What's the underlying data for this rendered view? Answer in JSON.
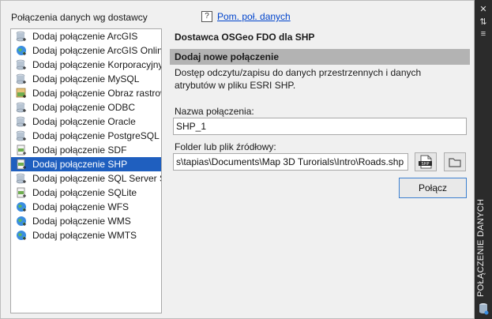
{
  "left_panel": {
    "title": "Połączenia danych wg dostawcy",
    "providers": [
      {
        "label": "Dodaj połączenie ArcGIS",
        "icon": "database-icon"
      },
      {
        "label": "Dodaj połączenie ArcGIS Online",
        "icon": "globe-icon"
      },
      {
        "label": "Dodaj połączenie Korporacyjny",
        "icon": "database-icon"
      },
      {
        "label": "Dodaj połączenie MySQL",
        "icon": "database-icon"
      },
      {
        "label": "Dodaj połączenie Obraz rastrowy",
        "icon": "raster-icon"
      },
      {
        "label": "Dodaj połączenie ODBC",
        "icon": "database-icon"
      },
      {
        "label": "Dodaj połączenie Oracle",
        "icon": "database-icon"
      },
      {
        "label": "Dodaj połączenie PostgreSQL",
        "icon": "database-icon"
      },
      {
        "label": "Dodaj połączenie SDF",
        "icon": "file-icon"
      },
      {
        "label": "Dodaj połączenie SHP",
        "icon": "file-icon",
        "selected": true
      },
      {
        "label": "Dodaj połączenie SQL Server Spatial",
        "icon": "database-icon"
      },
      {
        "label": "Dodaj połączenie SQLite",
        "icon": "file-icon"
      },
      {
        "label": "Dodaj połączenie WFS",
        "icon": "globe-icon"
      },
      {
        "label": "Dodaj połączenie WMS",
        "icon": "globe-icon"
      },
      {
        "label": "Dodaj połączenie WMTS",
        "icon": "globe-icon"
      }
    ]
  },
  "right_panel": {
    "help_icon": "?",
    "help_link": "Pom. poł. danych",
    "provider_title": "Dostawca OSGeo FDO dla SHP",
    "section_title": "Dodaj nowe połączenie",
    "description": "Dostęp odczytu/zapisu do danych przestrzennych i danych atrybutów w pliku ESRI SHP.",
    "connection_name_label": "Nazwa połączenia:",
    "connection_name_value": "SHP_1",
    "source_label": "Folder lub plik źródłowy:",
    "source_value": "s\\tapias\\Documents\\Map 3D Turorials\\Intro\\Roads.shp",
    "shp_button_text": "SHP",
    "connect_button": "Połącz"
  },
  "side_bar": {
    "title": "POŁĄCZENIE DANYCH",
    "close_icon": "✕",
    "pin_icon": "⇅",
    "menu_icon": "≡"
  },
  "colors": {
    "selection": "#1f5fbf",
    "section_bar": "#b3b3b3",
    "link": "#0044cc",
    "side_bar": "#2b2b2b"
  }
}
